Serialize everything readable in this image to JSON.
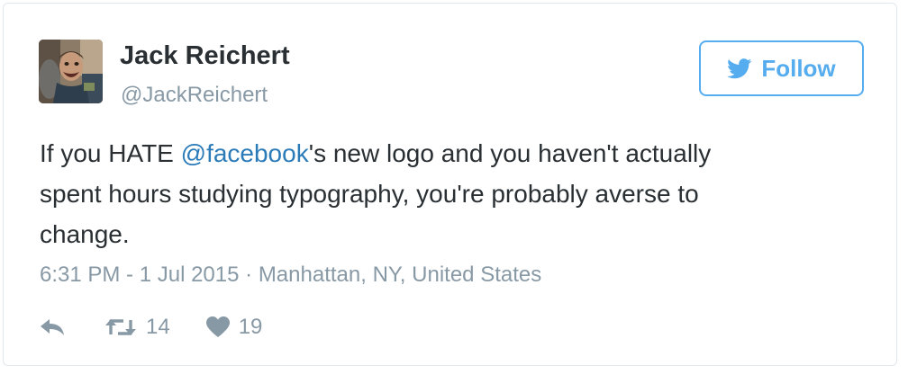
{
  "author": {
    "name": "Jack Reichert",
    "handle": "@JackReichert"
  },
  "follow_button": {
    "label": "Follow",
    "icon": "twitter-bird-icon"
  },
  "tweet": {
    "line1_before": "If you HATE ",
    "mention": "@facebook",
    "line1_after": "'s new logo and you haven't actually",
    "line2": "spent hours studying typography, you're probably averse to",
    "line3": "change."
  },
  "meta": {
    "timestamp": "6:31 PM - 1 Jul 2015",
    "separator": "·",
    "location": "Manhattan, NY, United States"
  },
  "actions": {
    "reply_icon": "reply-icon",
    "retweet_icon": "retweet-icon",
    "retweet_count": "14",
    "like_icon": "heart-icon",
    "like_count": "19"
  },
  "colors": {
    "brand_blue": "#55acee",
    "link_blue": "#2b7bb9",
    "text": "#292f33",
    "muted": "#8899a6",
    "border": "#e1e8ed"
  }
}
